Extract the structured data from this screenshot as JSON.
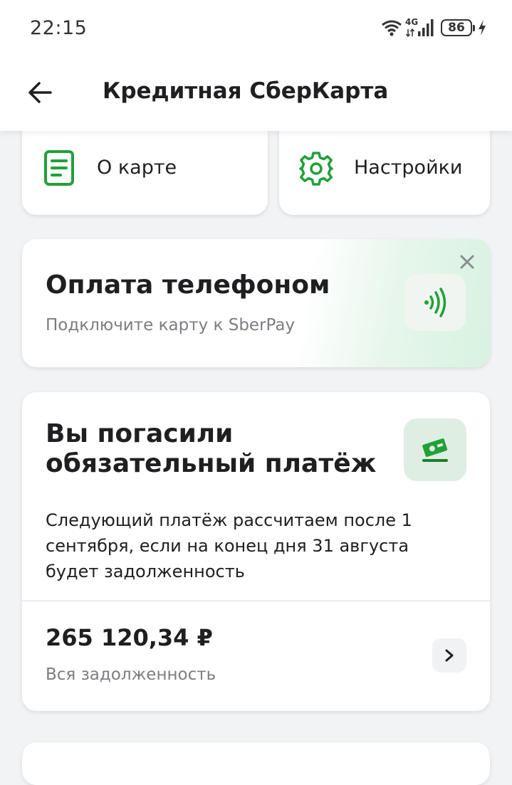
{
  "status_bar": {
    "time": "22:15",
    "network_label": "4G",
    "battery_level": "86",
    "icons": [
      "wifi-icon",
      "signal-icon",
      "battery-icon",
      "charging-icon"
    ]
  },
  "header": {
    "title": "Кредитная СберКарта",
    "back_icon": "arrow-left-icon"
  },
  "quick_actions": [
    {
      "label": "О карте",
      "icon": "document-icon"
    },
    {
      "label": "Настройки",
      "icon": "gear-icon"
    }
  ],
  "phone_payment": {
    "title": "Оплата телефоном",
    "subtitle": "Подключите карту к SberPay",
    "icon": "contactless-icon"
  },
  "debt": {
    "title": "Вы погасили обязательный платёж",
    "description": "Следующий платёж рассчитаем после 1 сентября, если на конец дня 31 августа будет задолженность",
    "amount": "265 120,34 ₽",
    "amount_label": "Вся задолженность",
    "icon": "money-icon"
  },
  "colors": {
    "accent": "#21a038",
    "accent_light": "#dfeee3",
    "text_primary": "#1f1f22",
    "text_secondary": "#7b7d82",
    "background": "#f2f3f5"
  }
}
